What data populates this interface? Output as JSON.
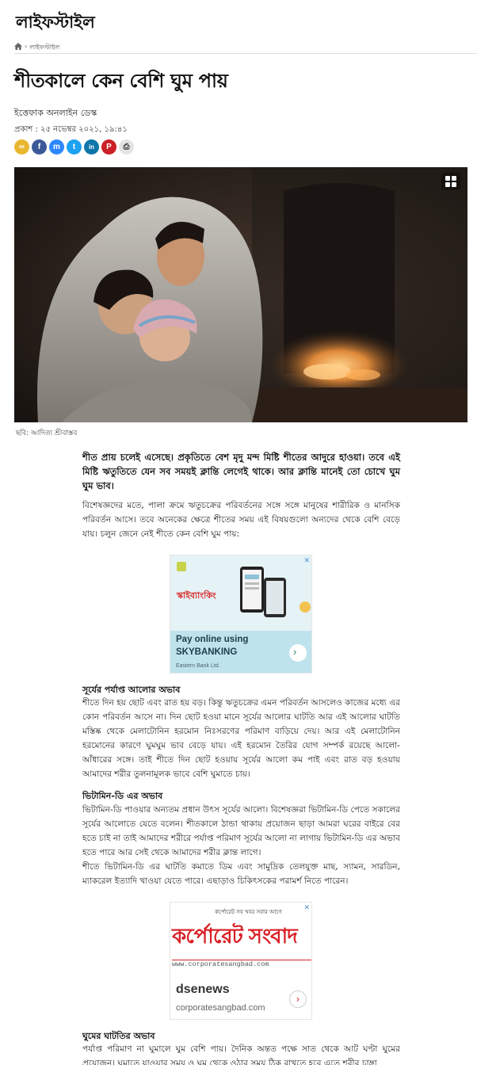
{
  "header": {
    "section_title": "লাইফস্টাইল"
  },
  "breadcrumb": {
    "home_icon": "home-icon",
    "current": "লাইফস্টাইল"
  },
  "article": {
    "headline": "শীতকালে কেন বেশি ঘুম পায়",
    "byline": "ইত্তেফাক অনলাইন ডেস্ক",
    "published": "প্রকাশ : ২৫ নভেম্বর ২০২১, ১৯:৪১",
    "image_caption": "ছবি: আদিত্য শ্রীবাস্তব",
    "lead": "শীত প্রায় চলেই এসেছে। প্রকৃতিতে বেশ মৃদু মন্দ মিষ্টি শীতের আদুরে হাওয়া। তবে এই মিষ্টি ঋতুতিতে যেন সব সময়ই ক্লান্তি লেগেই থাকে। আর ক্লান্তি মানেই তো চোখে ঘুম ঘুম ভাব।",
    "intro": "বিশেষজ্ঞদের মতে, পালা ক্রমে ঋতুচক্রের পরিবর্তনের সঙ্গে সঙ্গে মানুষের শারীরিক ও মানসিক পরিবর্তন আসে। তবে অনেকের ক্ষেত্রে শীতের সময় এই বিষয়গুলো অন্যদের থেকে বেশি বেড়ে যায়। চলুন জেনে নেই শীতে কেন বেশি ঘুম পায়:",
    "sections": [
      {
        "title": "সূর্যের পর্যাপ্ত আলোর অভাব",
        "paragraphs": [
          "শীতে দিন হয় ছোট এবং রাত হয় বড়। কিন্তু ঋতুচক্রের এমন পরিবর্তন আসলেও কাজের মধ্যে এর কোন পরিবর্তন আসে না। দিন ছোট হওয়া মানে সূর্যের আলোর ঘাটতি আর এই আলোর ঘাটতি মস্তিষ্ক থেকে মেলাটোনিন হরমোন নিঃসরণের পরিমাণ বাড়িয়ে দেয়। আর এই মেলাটোনিন হরমোনের কারণে ঘুমঘুম ভাব বেড়ে যায়। এই হরমোন তৈরির যোগ সম্পর্ক রয়েছে আলো-আঁধারের সঙ্গে। তাই শীতে দিন ছোট হওয়ায় সূর্যের আলো কম পাই এবং রাত বড় হওয়ায় আমাদের শরীর তুলনামূলক ভাবে বেশি ঘুমাতে চায়।"
        ]
      },
      {
        "title": "ভিটামিন-ডি এর অভাব",
        "paragraphs": [
          "ভিটামিন-ডি পাওয়ার অন্যতম প্রধান উৎস সূর্যের আলো। বিশেষজ্ঞরা ভিটামিন-ডি পেতে সকালের সূর্যের আলোতে যেতে বলেন। শীতকালে ঠান্ডা থাকায় প্রয়োজন ছাড়া আমরা ঘরের বাইরে বের হতে চাই না তাই আমাদের শরীরে পর্যাপ্ত পরিমাণ সূর্যের আলো না লাগায় ভিটামিন-ডি এর অভাব হতে পারে আর সেই থেকে আমাদের শরীর ক্লান্ত লাগে।",
          "শীতে ভিটামিন-ডি এর ঘাটতি কমাতে ডিম এবং সামুদ্রিক তেলযুক্ত মাছ, স্যামন, সারডিন, ম্যাকরেল ইত্যাদি খাওয়া যেতে পারে। এছাড়াও চিকিৎসকের পরামর্শ নিতে পারেন।"
        ]
      },
      {
        "title": "ঘুমের ঘাটতির অভাব",
        "paragraphs": [
          "পর্যাপ্ত পরিমাণ না ঘুমালে ঘুম বেশি পায়। দৈনিক অন্তত পক্ষে সাত থেকে আট ঘণ্টা ঘুমের প্রয়োজন। ঘুমাতে যাওয়ার সময় ও ঘুম থেকে ওঠার সময় ঠিক রাখতে হবে এতে শরীর চাঙ্গা"
        ]
      }
    ]
  },
  "share_buttons": [
    {
      "icon": "link-icon",
      "label": "∞",
      "color": "#e8b730"
    },
    {
      "icon": "facebook-icon",
      "label": "f",
      "color": "#3b5998"
    },
    {
      "icon": "messenger-icon",
      "label": "m",
      "color": "#2d88ff"
    },
    {
      "icon": "twitter-icon",
      "label": "t",
      "color": "#1da1f2"
    },
    {
      "icon": "linkedin-icon",
      "label": "in",
      "color": "#0e76a8"
    },
    {
      "icon": "pinterest-icon",
      "label": "P",
      "color": "#cb2027"
    },
    {
      "icon": "print-icon",
      "label": "⎙",
      "color": "#e4e4e4"
    }
  ],
  "ads": [
    {
      "brand_text": "স্কাইব্যাংকিং",
      "headline": "Pay online using SKYBANKING",
      "sponsor": "Eastern Bank Ltd.",
      "close": "✕"
    },
    {
      "tagline": "কর্পোরেট সব খবর সবার আগে",
      "logo_text": "কর্পোরেট সংবাদ",
      "url_strip": "www.corporatesangbad.com",
      "title": "dsenews",
      "domain": "corporatesangbad.com",
      "close": "✕"
    }
  ],
  "colors": {
    "accent_red": "#d91f26",
    "ad_teal": "#bfe3ec",
    "text": "#222222"
  }
}
